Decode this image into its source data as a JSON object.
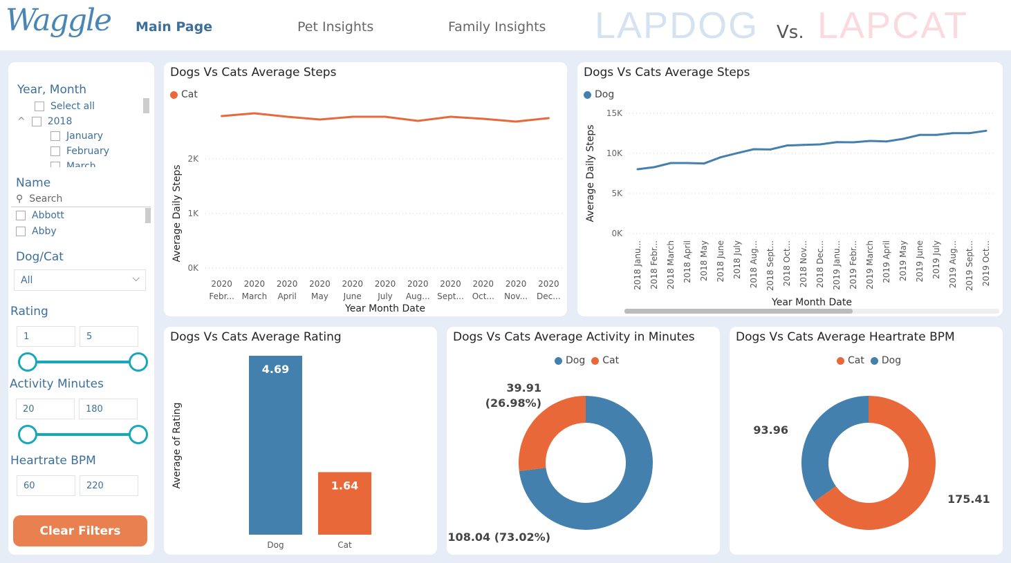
{
  "header": {
    "logo": "Waggle",
    "nav": [
      "Main Page",
      "Pet Insights",
      "Family Insights"
    ],
    "brand_left": "LAPDOG",
    "vs": "Vs.",
    "brand_right": "LAPCAT"
  },
  "colors": {
    "dog": "#4480ad",
    "cat": "#e8683a",
    "accent": "#16a8b8",
    "button": "#e8804f"
  },
  "sidebar": {
    "year_month": {
      "label": "Year, Month",
      "items": [
        "Select all",
        "2018",
        "January",
        "February",
        "March"
      ]
    },
    "name": {
      "label": "Name",
      "search_placeholder": "Search",
      "items": [
        "Abbott",
        "Abby"
      ]
    },
    "dogcat": {
      "label": "Dog/Cat",
      "value": "All"
    },
    "rating": {
      "label": "Rating",
      "min": "1",
      "max": "5"
    },
    "activity": {
      "label": "Activity Minutes",
      "min": "20",
      "max": "180"
    },
    "heartrate": {
      "label": "Heartrate BPM",
      "min": "60",
      "max": "220"
    },
    "clear_label": "Clear Filters"
  },
  "chart_data": [
    {
      "type": "line",
      "title": "Dogs Vs Cats Average Steps",
      "legend": [
        "Cat"
      ],
      "xlabel": "Year Month Date",
      "ylabel": "Average Daily Steps",
      "categories": [
        "2020 Febr...",
        "2020 March",
        "2020 April",
        "2020 May",
        "2020 June",
        "2020 July",
        "2020 Aug...",
        "2020 Sept...",
        "2020 Oct...",
        "2020 Nov...",
        "2020 Dec..."
      ],
      "yticks": [
        "0K",
        "1K",
        "2K"
      ],
      "ylim": [
        0,
        2800
      ],
      "series": [
        {
          "name": "Cat",
          "values": [
            2785,
            2835,
            2772,
            2722,
            2772,
            2772,
            2696,
            2772,
            2734,
            2684,
            2747
          ]
        }
      ]
    },
    {
      "type": "line",
      "title": "Dogs Vs Cats Average Steps",
      "legend": [
        "Dog"
      ],
      "xlabel": "Year Month Date",
      "ylabel": "Average Daily Steps",
      "categories": [
        "2018 Janu...",
        "2018 Febr...",
        "2018 March",
        "2018 April",
        "2018 May",
        "2018 June",
        "2018 July",
        "2018 Aug...",
        "2018 Sept...",
        "2018 Oct...",
        "2018 Nov...",
        "2018 Dec...",
        "2019 Janu...",
        "2019 Febr...",
        "2019 March",
        "2019 April",
        "2019 May",
        "2019 June",
        "2019 July",
        "2019 Aug...",
        "2019 Sept...",
        "2019 Oct..."
      ],
      "yticks": [
        "0K",
        "5K",
        "10K",
        "15K"
      ],
      "ylim": [
        0,
        15000
      ],
      "series": [
        {
          "name": "Dog",
          "values": [
            8017,
            8276,
            8793,
            8793,
            8733,
            9509,
            10026,
            10517,
            10490,
            10977,
            11060,
            11121,
            11405,
            11379,
            11552,
            11491,
            11810,
            12302,
            12302,
            12526,
            12526,
            12819
          ]
        }
      ]
    },
    {
      "type": "bar",
      "title": "Dogs Vs Cats Average Rating",
      "ylabel": "Average of Rating",
      "categories": [
        "Dog",
        "Cat"
      ],
      "values": [
        4.69,
        1.64
      ],
      "labels": [
        "4.69",
        "1.64"
      ],
      "ylim": [
        0,
        4.69
      ]
    },
    {
      "type": "pie",
      "title": "Dogs Vs Cats Average Activity in Minutes",
      "legend": [
        "Dog",
        "Cat"
      ],
      "slices": [
        {
          "name": "Dog",
          "value": 108.04,
          "label": "108.04 (73.02%)"
        },
        {
          "name": "Cat",
          "value": 39.91,
          "label": "39.91 (26.98%)"
        }
      ]
    },
    {
      "type": "pie",
      "title": "Dogs Vs Cats Average Heartrate BPM",
      "legend": [
        "Cat",
        "Dog"
      ],
      "slices": [
        {
          "name": "Cat",
          "value": 175.41,
          "label": "175.41"
        },
        {
          "name": "Dog",
          "value": 93.96,
          "label": "93.96"
        }
      ]
    }
  ]
}
